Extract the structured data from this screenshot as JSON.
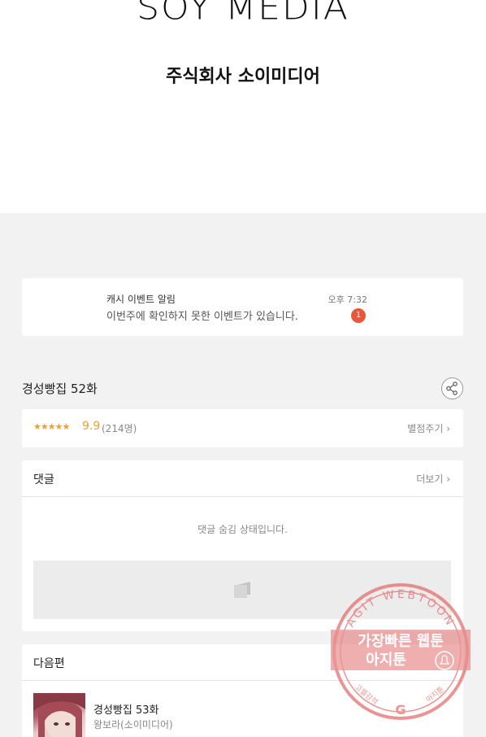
{
  "publisher": {
    "logo_text": "SOY MEDIA",
    "company_name": "주식회사 소이미디어"
  },
  "notification": {
    "title": "캐시 이벤트 알림",
    "message": "이번주에 확인하지 못한 이벤트가 있습니다.",
    "time": "오후 7:32",
    "badge_count": "1"
  },
  "episode": {
    "title": "경성빵집 52화",
    "share_icon": "share-icon"
  },
  "rating": {
    "stars": "★★★★★",
    "score": "9.9",
    "count": "(214명)",
    "rate_label": "별점주기 ›"
  },
  "comments": {
    "title": "댓글",
    "more_label": "더보기 ›",
    "hidden_message": "댓글 숨김 상태입니다."
  },
  "next_episode": {
    "section_title": "다음편",
    "title": "경성빵집 53화",
    "author": "왕보라(소이미디어)"
  },
  "watermark": {
    "arc_text": "AGIT WEBTOON",
    "line1": "가장빠른 웹툰",
    "line2": "아지툰",
    "bottom_left": "고퀄감석",
    "bottom_right": "아지툰",
    "color": "#e36b6b"
  },
  "colors": {
    "accent_star": "#f0a21e",
    "badge": "#e8563b",
    "page_bg": "#f2f2f2"
  }
}
